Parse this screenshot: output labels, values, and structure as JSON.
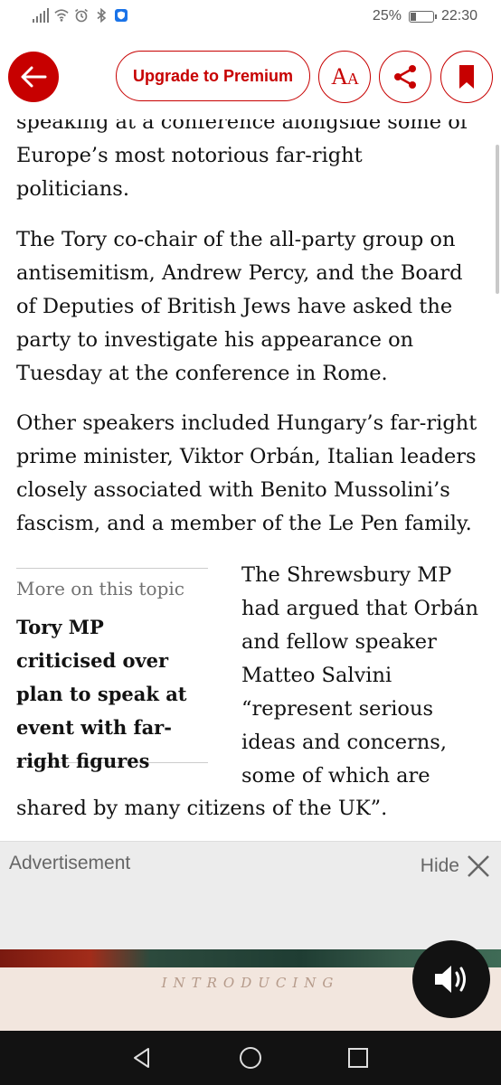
{
  "status_bar": {
    "battery_percent": "25%",
    "battery_level": 0.25,
    "time": "22:30",
    "icons": [
      "signal-icon",
      "wifi-icon",
      "alarm-icon",
      "bluetooth-icon",
      "shield-app-icon"
    ]
  },
  "toolbar": {
    "premium_label": "Upgrade to Premium",
    "text_size_label": "A",
    "text_size_label_small": "A",
    "accent_color": "#c70000"
  },
  "article": {
    "para1": "speaking at a conference alongside some of Europe’s most notorious far-right politicians.",
    "para1_lines": [
      "speaking at a conference alongside some of",
      "Europe’s most notorious far-right",
      "politicians."
    ],
    "para2_lines": [
      "The Tory co-chair of the all-party group on",
      "antisemitism, Andrew Percy, and the Board",
      "of Deputies of British Jews have asked the",
      "party to investigate his appearance on",
      "Tuesday at the conference in Rome."
    ],
    "para3_lines": [
      "Other speakers included Hungary’s far-right",
      "prime minister, Viktor Orbán, Italian leaders",
      "closely associated with Benito Mussolini’s",
      "fascism, and a member of the Le Pen family."
    ],
    "para4_wrap_lines": [
      "The Shrewsbury MP",
      "had argued that Orbán",
      "and fellow speaker",
      "Matteo Salvini",
      "“represent serious",
      "ideas and concerns,",
      "some of which are"
    ],
    "para4_last_line": "shared by many citizens of the UK”."
  },
  "related": {
    "kicker": "More on this topic",
    "title": "Tory MP criticised over plan to speak at event with far-right figures"
  },
  "advertisement": {
    "label": "Advertisement",
    "hide_label": "Hide",
    "intro_text": "INTRODUCING"
  }
}
